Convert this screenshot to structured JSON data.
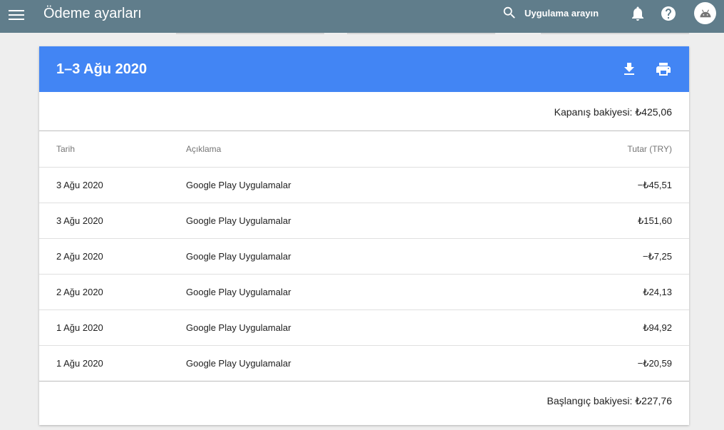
{
  "app": {
    "title": "Ödeme ayarları",
    "search_label": "Uygulama arayın",
    "icons": [
      "menu-icon",
      "search-icon",
      "notifications-icon",
      "help-icon",
      "android-icon"
    ],
    "colors": {
      "topbar": "#607d8b",
      "card_header": "#4285f4",
      "background": "#eeeeee"
    }
  },
  "statement": {
    "period": "1–3 Ağu 2020",
    "closing_balance": "Kapanış bakiyesi: ₺425,06",
    "opening_balance": "Başlangıç bakiyesi: ₺227,76",
    "columns": {
      "date": "Tarih",
      "description": "Açıklama",
      "amount": "Tutar (TRY)"
    },
    "rows": [
      {
        "date": "3 Ağu 2020",
        "description": "Google Play Uygulamalar",
        "amount": "−₺45,51"
      },
      {
        "date": "3 Ağu 2020",
        "description": "Google Play Uygulamalar",
        "amount": "₺151,60"
      },
      {
        "date": "2 Ağu 2020",
        "description": "Google Play Uygulamalar",
        "amount": "−₺7,25"
      },
      {
        "date": "2 Ağu 2020",
        "description": "Google Play Uygulamalar",
        "amount": "₺24,13"
      },
      {
        "date": "1 Ağu 2020",
        "description": "Google Play Uygulamalar",
        "amount": "₺94,92"
      },
      {
        "date": "1 Ağu 2020",
        "description": "Google Play Uygulamalar",
        "amount": "−₺20,59"
      }
    ]
  }
}
